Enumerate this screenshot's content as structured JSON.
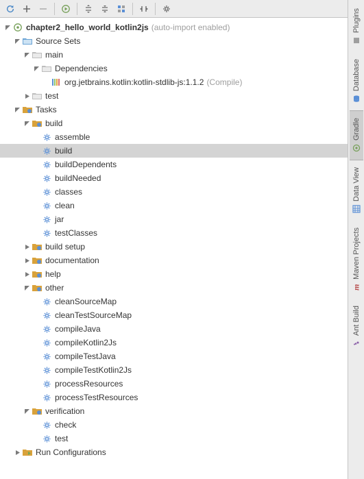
{
  "project": {
    "name": "chapter2_hello_world_kotlin2js",
    "hint": "(auto-import enabled)"
  },
  "sourceSets": {
    "label": "Source Sets",
    "main": {
      "label": "main",
      "deps_label": "Dependencies",
      "dep_item": "org.jetbrains.kotlin:kotlin-stdlib-js:1.1.2",
      "dep_scope": "(Compile)"
    },
    "test": {
      "label": "test"
    }
  },
  "tasks": {
    "label": "Tasks",
    "build": {
      "label": "build",
      "items": [
        "assemble",
        "build",
        "buildDependents",
        "buildNeeded",
        "classes",
        "clean",
        "jar",
        "testClasses"
      ]
    },
    "build_setup": {
      "label": "build setup"
    },
    "documentation": {
      "label": "documentation"
    },
    "help": {
      "label": "help"
    },
    "other": {
      "label": "other",
      "items": [
        "cleanSourceMap",
        "cleanTestSourceMap",
        "compileJava",
        "compileKotlin2Js",
        "compileTestJava",
        "compileTestKotlin2Js",
        "processResources",
        "processTestResources"
      ]
    },
    "verification": {
      "label": "verification",
      "items": [
        "check",
        "test"
      ]
    }
  },
  "run_configs": {
    "label": "Run Configurations"
  },
  "sidebar": {
    "tabs": [
      "Plugins",
      "Database",
      "Gradle",
      "Data View",
      "Maven Projects",
      "Ant Build"
    ]
  }
}
